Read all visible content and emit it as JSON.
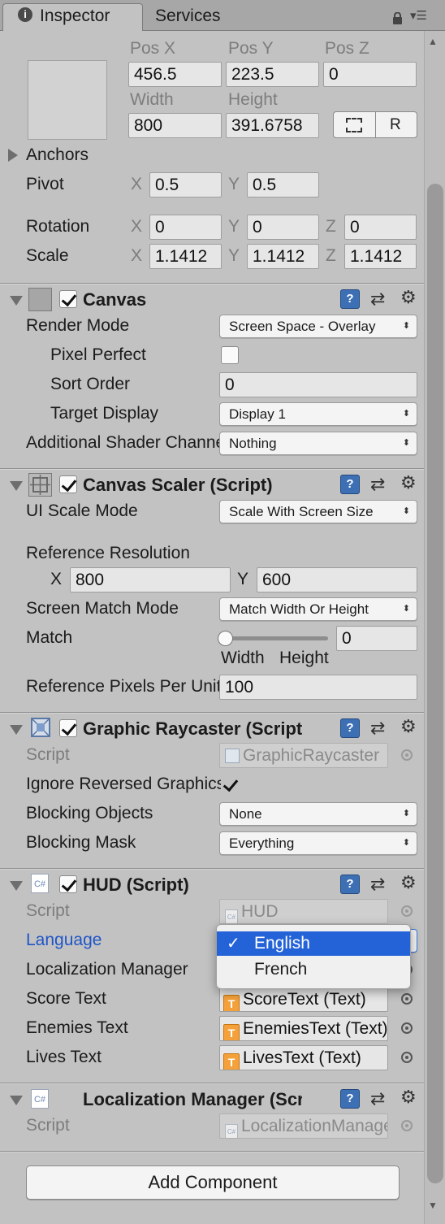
{
  "tabs": {
    "inspector": "Inspector",
    "services": "Services"
  },
  "rect": {
    "pos_x_label": "Pos X",
    "pos_y_label": "Pos Y",
    "pos_z_label": "Pos Z",
    "pos_x": "456.5",
    "pos_y": "223.5",
    "pos_z": "0",
    "width_label": "Width",
    "height_label": "Height",
    "width": "800",
    "height": "391.6758",
    "blueprint_btn": "⬚",
    "raw_btn": "R",
    "anchors_label": "Anchors",
    "pivot_label": "Pivot",
    "pivot_x": "0.5",
    "pivot_y": "0.5",
    "rotation_label": "Rotation",
    "rot_x": "0",
    "rot_y": "0",
    "rot_z": "0",
    "scale_label": "Scale",
    "scale_x": "1.1412",
    "scale_y": "1.1412",
    "scale_z": "1.1412",
    "x": "X",
    "y": "Y",
    "z": "Z"
  },
  "canvas": {
    "title": "Canvas",
    "render_mode_label": "Render Mode",
    "render_mode": "Screen Space - Overlay",
    "pixel_perfect_label": "Pixel Perfect",
    "sort_order_label": "Sort Order",
    "sort_order": "0",
    "target_display_label": "Target Display",
    "target_display": "Display 1",
    "shader_label": "Additional Shader Channels",
    "shader": "Nothing"
  },
  "scaler": {
    "title": "Canvas Scaler (Script)",
    "ui_scale_label": "UI Scale Mode",
    "ui_scale": "Scale With Screen Size",
    "ref_res_label": "Reference Resolution",
    "ref_x": "800",
    "ref_y": "600",
    "match_mode_label": "Screen Match Mode",
    "match_mode": "Match Width Or Height",
    "match_label": "Match",
    "match_value": "0",
    "width_label": "Width",
    "height_label": "Height",
    "ppu_label": "Reference Pixels Per Unit",
    "ppu": "100"
  },
  "raycaster": {
    "title": "Graphic Raycaster (Script)",
    "script_label": "Script",
    "script": "GraphicRaycaster",
    "ignore_label": "Ignore Reversed Graphics",
    "blocking_obj_label": "Blocking Objects",
    "blocking_obj": "None",
    "blocking_mask_label": "Blocking Mask",
    "blocking_mask": "Everything"
  },
  "hud": {
    "title": "HUD (Script)",
    "script_label": "Script",
    "script": "HUD",
    "language_label": "Language",
    "loc_label": "Localization Manager",
    "score_label": "Score Text",
    "score": "ScoreText (Text)",
    "enemies_label": "Enemies Text",
    "enemies": "EnemiesText (Text)",
    "lives_label": "Lives Text",
    "lives": "LivesText (Text)",
    "popup_options": [
      "English",
      "French"
    ],
    "check": "✓"
  },
  "locmgr": {
    "title": "Localization Manager (Script)",
    "script_label": "Script",
    "script": "LocalizationManager"
  },
  "add_component": "Add Component",
  "icons": {
    "cs": "C#",
    "t": "T",
    "book": "?",
    "preset": "⇄",
    "gear": "⚙",
    "menu": "▾≡",
    "lock": "🔒",
    "arrow": "⬍"
  },
  "colors": {
    "accent": "#2463d7",
    "language_label": "#1f55c8",
    "panel_bg": "#c2c2c2"
  }
}
